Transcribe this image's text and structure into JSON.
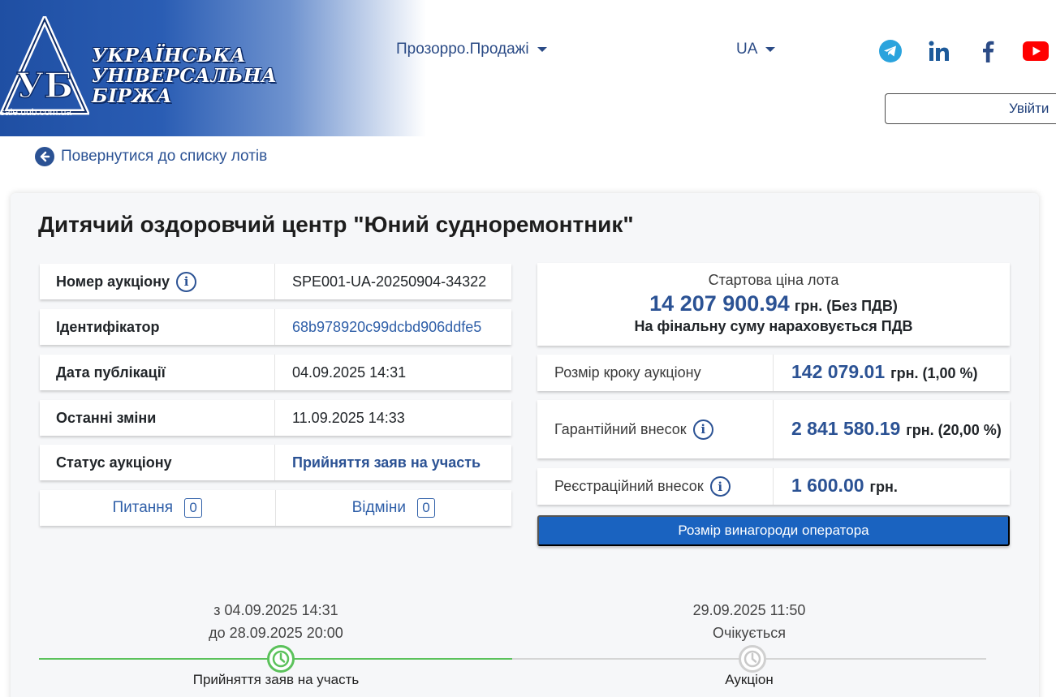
{
  "header": {
    "logo": {
      "line1": "УКРАЇНСЬКА",
      "line2": "УНІВЕРСАЛЬНА",
      "line3": "БІРЖА",
      "url": "sale.uub.com.ua"
    },
    "nav_prozorro": "Прозорро.Продажі",
    "nav_lang": "UA",
    "social_icons": [
      "telegram-icon",
      "linkedin-icon",
      "facebook-icon",
      "youtube-icon"
    ],
    "login_label": "Увійти"
  },
  "back_link": "Повернутися до списку лотів",
  "lot": {
    "title": "Дитячий оздоровчий центр \"Юний судноремонтник\"",
    "info": [
      {
        "key": "Номер аукціону",
        "value": "SPE001-UA-20250904-34322"
      },
      {
        "key": "Ідентифікатор",
        "value": "68b978920c99dcbd906ddfe5"
      },
      {
        "key": "Дата публікації",
        "value": "04.09.2025 14:31"
      },
      {
        "key": "Останні зміни",
        "value": "11.09.2025 14:33"
      },
      {
        "key": "Статус аукціону",
        "value": "Прийняття заяв на участь"
      }
    ],
    "questions": {
      "label": "Питання",
      "count": "0"
    },
    "cancellations": {
      "label": "Відміни",
      "count": "0"
    },
    "price": {
      "label": "Стартова ціна лота",
      "amount": "14 207 900.94",
      "suffix": "грн. (Без ПДВ)",
      "vat_note": "На фінальну суму нараховується ПДВ"
    },
    "params": [
      {
        "key": "Розмір кроку аукціону",
        "amount": "142 079.01",
        "suffix": "грн. (1,00 %)"
      },
      {
        "key": "Гарантійний внесок",
        "amount": "2 841 580.19",
        "suffix": "грн. (20,00 %)"
      },
      {
        "key": "Реєстраційний внесок",
        "amount": "1 600.00",
        "suffix": "грн."
      }
    ],
    "reward_button": "Розмір винагороди оператора"
  },
  "timeline": [
    {
      "line1": "з 04.09.2025 14:31",
      "line2": "до 28.09.2025 20:00",
      "label": "Прийняття заяв на участь",
      "state": "active"
    },
    {
      "line1": "29.09.2025 11:50",
      "line2": "Очікується",
      "label": "Аукціон",
      "state": "pending"
    }
  ],
  "colors": {
    "brand_blue": "#2b5294",
    "button_blue": "#1a63c0",
    "timeline_active": "#5bc25b",
    "timeline_pending": "#cccccc"
  }
}
